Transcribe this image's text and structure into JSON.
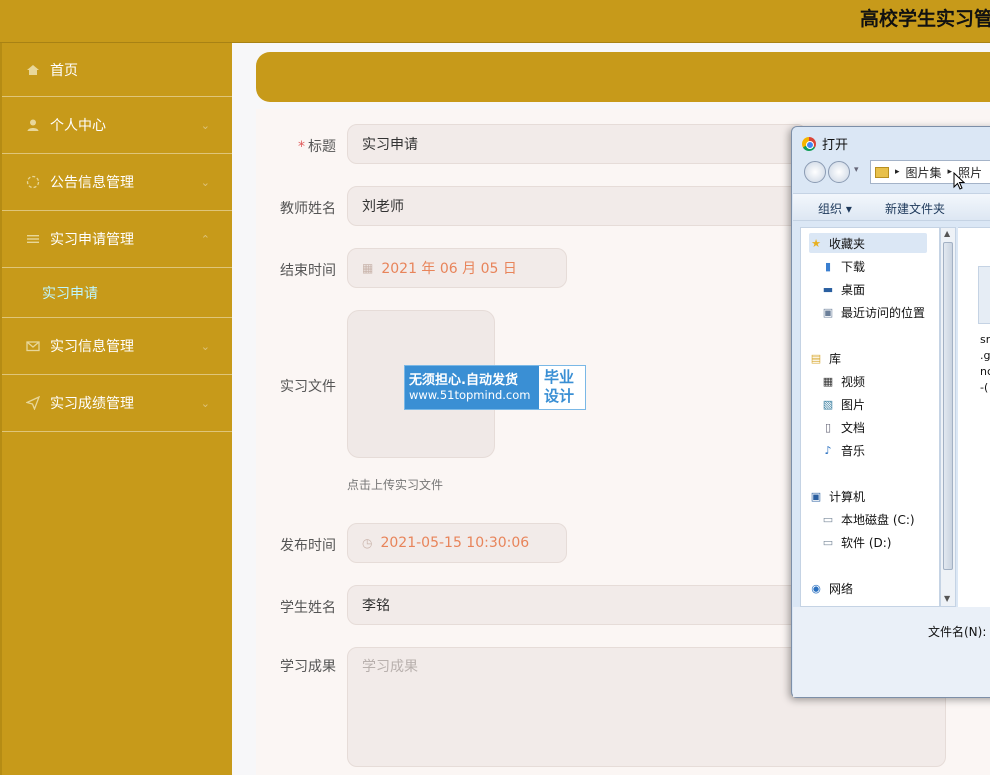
{
  "header": {
    "title": "高校学生实习管"
  },
  "sidebar": {
    "items": [
      {
        "label": "首页",
        "icon": "home-icon"
      },
      {
        "label": "个人中心",
        "icon": "user-icon"
      },
      {
        "label": "公告信息管理",
        "icon": "notice-icon"
      },
      {
        "label": "实习申请管理",
        "icon": "list-icon"
      },
      {
        "label": "实习信息管理",
        "icon": "mail-icon"
      },
      {
        "label": "实习成绩管理",
        "icon": "send-icon"
      }
    ],
    "sub_item": "实习申请"
  },
  "form": {
    "title_label": "标题",
    "title_value": "实习申请",
    "teacher_label": "教师姓名",
    "teacher_value": "刘老师",
    "end_label": "结束时间",
    "end_value": "2021 年 06 月 05 日",
    "file_label": "实习文件",
    "file_hint": "点击上传实习文件",
    "publish_label": "发布时间",
    "publish_value": "2021-05-15 10:30:06",
    "student_label": "学生姓名",
    "student_value": "李铭",
    "result_label": "学习成果",
    "result_placeholder": "学习成果"
  },
  "watermark": {
    "line1": "无须担心.自动发货",
    "line2": "www.51topmind.com",
    "right1": "毕业",
    "right2": "设计"
  },
  "dialog": {
    "title": "打开",
    "path1": "图片集",
    "path2": "照片",
    "organize": "组织 ▾",
    "new_folder": "新建文件夹",
    "tree": {
      "favorites": "收藏夹",
      "downloads": "下载",
      "desktop": "桌面",
      "recent": "最近访问的位置",
      "libraries": "库",
      "videos": "视频",
      "pictures": "图片",
      "documents": "文档",
      "music": "音乐",
      "computer": "计算机",
      "drive_c": "本地磁盘 (C:)",
      "drive_d": "软件 (D:)",
      "network": "网络"
    },
    "file_fragments": [
      "sr",
      ".g",
      "nc",
      "-("
    ],
    "filename_label": "文件名(N):"
  }
}
